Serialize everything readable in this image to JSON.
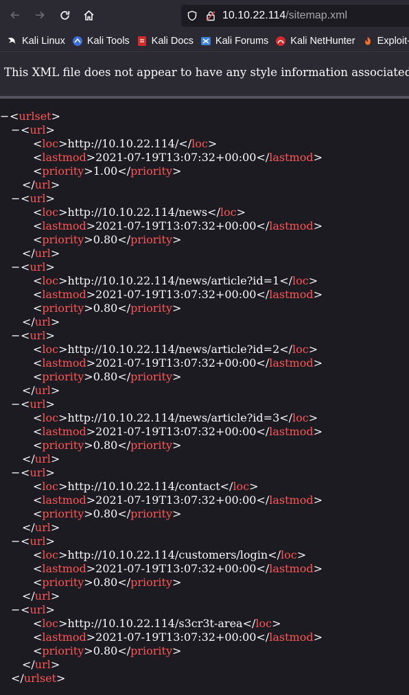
{
  "browser": {
    "url_host": "10.10.22.114",
    "url_path": "/sitemap.xml"
  },
  "bookmarks": [
    {
      "label": "Kali Linux",
      "icon": "kali-dragon-icon"
    },
    {
      "label": "Kali Tools",
      "icon": "kali-tools-icon"
    },
    {
      "label": "Kali Docs",
      "icon": "kali-docs-icon"
    },
    {
      "label": "Kali Forums",
      "icon": "kali-forums-icon"
    },
    {
      "label": "Kali NetHunter",
      "icon": "kali-nethunter-icon"
    },
    {
      "label": "Exploit-",
      "icon": "exploit-db-icon"
    }
  ],
  "banner": {
    "text": "This XML file does not appear to have any style information associated w"
  },
  "xml": {
    "root_tag": "urlset",
    "url_tag": "url",
    "loc_tag": "loc",
    "lastmod_tag": "lastmod",
    "priority_tag": "priority",
    "collapse_symbol": "−",
    "urls": [
      {
        "loc": "http://10.10.22.114/",
        "lastmod": "2021-07-19T13:07:32+00:00",
        "priority": "1.00"
      },
      {
        "loc": "http://10.10.22.114/news",
        "lastmod": "2021-07-19T13:07:32+00:00",
        "priority": "0.80"
      },
      {
        "loc": "http://10.10.22.114/news/article?id=1",
        "lastmod": "2021-07-19T13:07:32+00:00",
        "priority": "0.80"
      },
      {
        "loc": "http://10.10.22.114/news/article?id=2",
        "lastmod": "2021-07-19T13:07:32+00:00",
        "priority": "0.80"
      },
      {
        "loc": "http://10.10.22.114/news/article?id=3",
        "lastmod": "2021-07-19T13:07:32+00:00",
        "priority": "0.80"
      },
      {
        "loc": "http://10.10.22.114/contact",
        "lastmod": "2021-07-19T13:07:32+00:00",
        "priority": "0.80"
      },
      {
        "loc": "http://10.10.22.114/customers/login",
        "lastmod": "2021-07-19T13:07:32+00:00",
        "priority": "0.80"
      },
      {
        "loc": "http://10.10.22.114/s3cr3t-area",
        "lastmod": "2021-07-19T13:07:32+00:00",
        "priority": "0.80"
      }
    ]
  }
}
